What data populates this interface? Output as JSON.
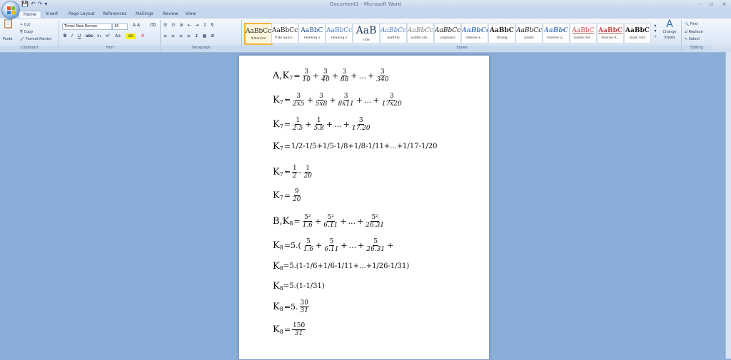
{
  "window": {
    "title": "Document1 - Microsoft Word",
    "controls": [
      "–",
      "▫",
      "×"
    ]
  },
  "qat": [
    "💾",
    "↶",
    "↷",
    "▾"
  ],
  "tabs": [
    "Home",
    "Insert",
    "Page Layout",
    "References",
    "Mailings",
    "Review",
    "View"
  ],
  "clipboard": {
    "cut": "Cut",
    "copy": "Copy",
    "paste": "Paste",
    "painter": "Format Painter",
    "label": "Clipboard"
  },
  "font": {
    "family": "Times New Roman",
    "size": "16",
    "label": "Font",
    "buttons": [
      "B",
      "I",
      "U",
      "abc",
      "x₂",
      "x²",
      "Aa"
    ]
  },
  "paragraph": {
    "label": "Paragraph"
  },
  "styles": {
    "label": "Styles",
    "items": [
      {
        "preview": "AaBbCc",
        "name": "¶ Normal"
      },
      {
        "preview": "AaBbCc",
        "name": "¶ No Spaci..."
      },
      {
        "preview": "AaBbC",
        "name": "Heading 1"
      },
      {
        "preview": "AaBbCc",
        "name": "Heading 2"
      },
      {
        "preview": "AaB",
        "name": "Title"
      },
      {
        "preview": "AaBbCc.",
        "name": "Subtitle"
      },
      {
        "preview": "AaBbCc",
        "name": "Subtle Em..."
      },
      {
        "preview": "AaBbCc",
        "name": "Emphasis"
      },
      {
        "preview": "AaBbCc",
        "name": "Intense E..."
      },
      {
        "preview": "AaBbC",
        "name": "Strong"
      },
      {
        "preview": "AaBbCc",
        "name": "Quote"
      },
      {
        "preview": "AaBbC",
        "name": "Intense Q..."
      },
      {
        "preview": "AaBbC",
        "name": "Subtle Ref..."
      },
      {
        "preview": "AaBbC",
        "name": "Intense R..."
      },
      {
        "preview": "AaBbC",
        "name": "Book Title"
      }
    ],
    "change": "Change Styles"
  },
  "editing": {
    "label": "Editing",
    "find": "Find",
    "replace": "Replace",
    "select": "Select"
  },
  "doc": {
    "lineA": {
      "label": "A,K",
      "sub": "7",
      "eq": "=",
      "fracs": [
        [
          "3",
          "10"
        ],
        [
          "3",
          "40"
        ],
        [
          "3",
          "88"
        ]
      ],
      "dots": "...",
      "last": [
        "3",
        "340"
      ]
    },
    "line2": {
      "label": "K",
      "sub": "7",
      "fracs": [
        [
          "3",
          "2x5"
        ],
        [
          "3",
          "5x8"
        ],
        [
          "3",
          "8x11"
        ]
      ],
      "dots": "...",
      "last": [
        "3",
        "17x20"
      ]
    },
    "line3": {
      "label": "K",
      "sub": "7",
      "fracs": [
        [
          "1",
          "2.5"
        ],
        [
          "1",
          "5.8"
        ]
      ],
      "dots": "...",
      "last": [
        "3",
        "17.20"
      ]
    },
    "line4": {
      "label": "K",
      "sub": "7",
      "text": "1/2-1/5+1/5-1/8+1/8-1/11+...+1/17-1/20"
    },
    "line5": {
      "label": "K",
      "sub": "7",
      "fracs": [
        [
          "1",
          "2"
        ],
        [
          "1",
          "20"
        ]
      ]
    },
    "line6": {
      "label": "K",
      "sub": "7",
      "frac": [
        "9",
        "20"
      ]
    },
    "lineB": {
      "label": "B,K",
      "sub": "8",
      "fracs": [
        [
          "5²",
          "1.6"
        ],
        [
          "5²",
          "6.11"
        ]
      ],
      "dots": "...",
      "last": [
        "5²",
        "26.31"
      ]
    },
    "line8": {
      "label": "K",
      "sub": "8",
      "prefix": "=5.(",
      "fracs": [
        [
          "5",
          "1.6"
        ],
        [
          "5",
          "6.11"
        ]
      ],
      "dots": "...",
      "last": [
        "5",
        "26.31"
      ],
      "suffix": "+"
    },
    "line9": {
      "label": "K",
      "sub": "8",
      "text": "=5.(1-1/6+1/6-1/11+...+1/26-1/31)"
    },
    "line10": {
      "label": "K",
      "sub": "8",
      "text": "=5.(1-1/31)"
    },
    "line11": {
      "label": "K",
      "sub": "8",
      "prefix": "=5.",
      "frac": [
        "30",
        "31"
      ]
    },
    "line12": {
      "label": "K",
      "sub": "8",
      "prefix": "=",
      "frac": [
        "150",
        "31"
      ]
    }
  }
}
